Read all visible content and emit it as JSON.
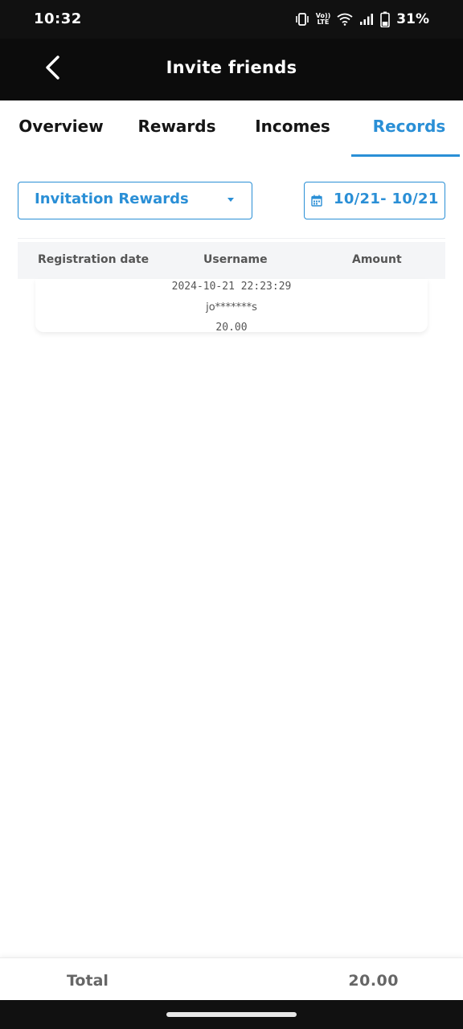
{
  "status_bar": {
    "time": "10:32",
    "volte_top": "Vo))",
    "volte_bottom": "LTE",
    "battery_percent": "31%",
    "icons": [
      "vibrate-icon",
      "volte-icon",
      "wifi-icon",
      "signal-icon",
      "battery-icon"
    ]
  },
  "header": {
    "title": "Invite friends",
    "back_icon": "chevron-left-icon"
  },
  "tabs": [
    {
      "label": "Overview",
      "active": false
    },
    {
      "label": "Rewards",
      "active": false
    },
    {
      "label": "Incomes",
      "active": false
    },
    {
      "label": "Records",
      "active": true
    }
  ],
  "filters": {
    "type_selected": "Invitation Rewards",
    "date_range": "10/21- 10/21",
    "calendar_icon": "calendar-icon",
    "caret_icon": "caret-down-icon"
  },
  "table": {
    "columns": [
      "Registration date",
      "Username",
      "Amount"
    ],
    "rows": [
      {
        "registration_date": "2024-10-21 22:23:29",
        "username": "jo*******s",
        "amount": "20.00"
      }
    ]
  },
  "footer": {
    "total_label": "Total",
    "total_value": "20.00"
  },
  "colors": {
    "accent": "#2a8fd6",
    "header_bg": "#0c0c0c",
    "table_header_bg": "#f4f5f7"
  }
}
